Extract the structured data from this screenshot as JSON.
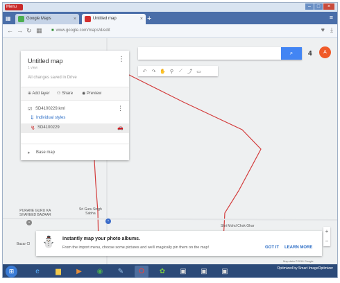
{
  "browser": {
    "menu_label": "Menu",
    "tabs": [
      {
        "label": "Google Maps",
        "favicon_color": "#4caf50"
      },
      {
        "label": "Untitled map",
        "favicon_color": "#d32f2f"
      }
    ],
    "new_tab": "+",
    "url": "www.google.com/maps/d/edit"
  },
  "panel": {
    "title": "Untitled map",
    "subtitle": "1 view",
    "saved_status": "All changes saved in Drive",
    "actions": {
      "add_layer": "Add layer",
      "share": "Share",
      "preview": "Preview"
    },
    "layer": {
      "name": "SD4100229.kml",
      "style_link": "Individual styles",
      "item": "SD4100229"
    },
    "base_map": "Base map"
  },
  "search": {
    "placeholder": "",
    "button_icon": "search-icon"
  },
  "user": {
    "avatar_initial": "A",
    "apps_badge": "4"
  },
  "map": {
    "places": [
      {
        "label": "PURANE GURU KA\nSHAHEED BAZAAR"
      },
      {
        "label": "Sri Guru Singh\nSabha"
      },
      {
        "label": "Shri Mohd Chok Ghar"
      },
      {
        "label": "Bazar Cl"
      }
    ],
    "attribution": "Map data ©2016 Google"
  },
  "banner": {
    "title": "Instantly map your photo albums.",
    "body": "From the import menu, choose some pictures and we'll magically pin them on the map!",
    "got_it": "GOT IT",
    "learn_more": "LEARN MORE"
  },
  "taskbar": {
    "tray": "Optimized by Smart ImageOptimizer"
  },
  "colors": {
    "route": "#d33b3b",
    "accent": "#4285f4",
    "avatar": "#f05a28"
  }
}
